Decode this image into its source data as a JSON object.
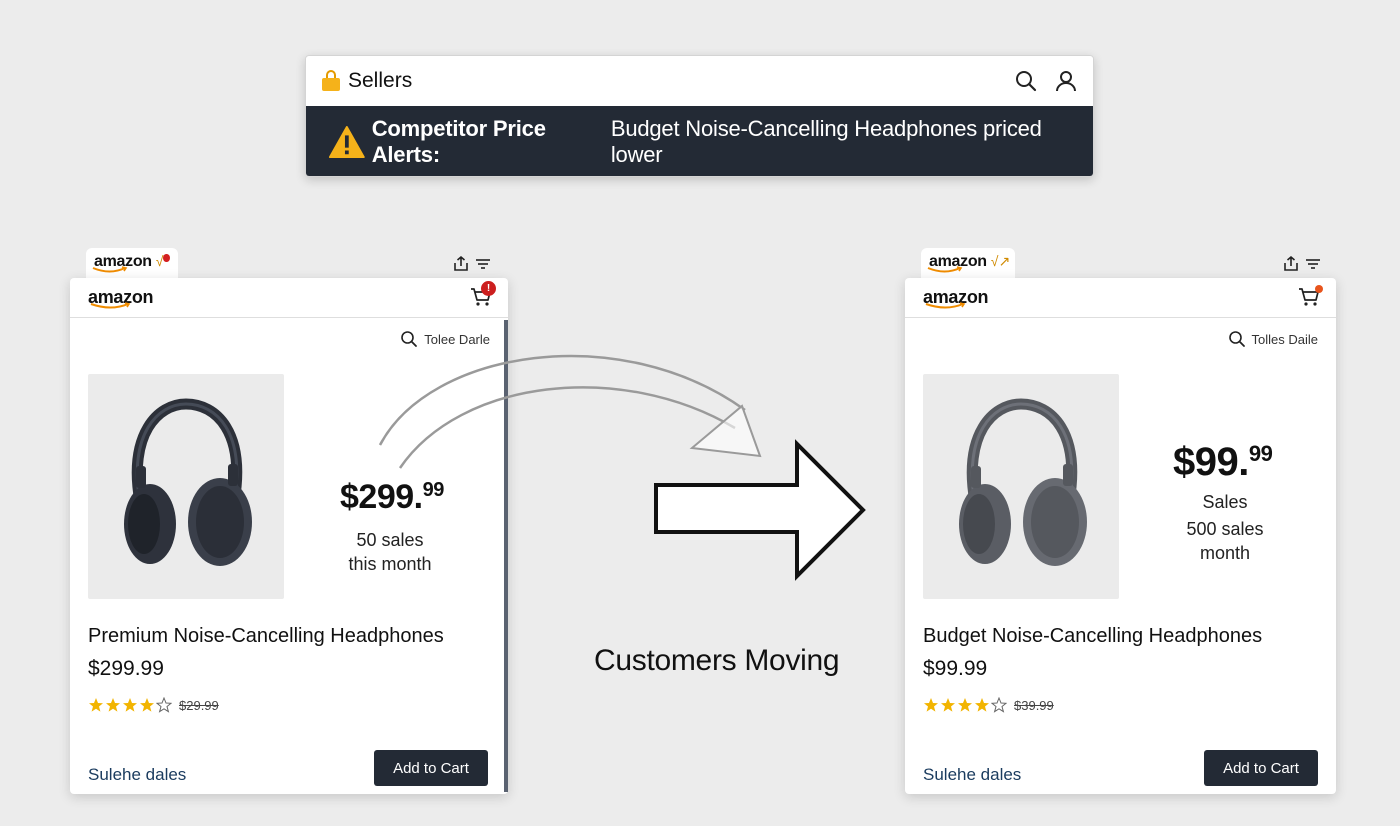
{
  "seller_header": {
    "title": "Sellers",
    "alert_label": "Competitor Price Alerts:",
    "alert_message": "Budget Noise-Cancelling Headphones priced lower"
  },
  "left_card": {
    "tab_logo": "amazon",
    "tab_extra": "√",
    "logo": "amazon",
    "cart_badge": "!",
    "search_text": "Tolee Darle",
    "price_main": "$299.",
    "price_cents": "99",
    "sales_line1": "50 sales",
    "sales_line2": "this month",
    "product_name": "Premium Noise-Cancelling Headphones",
    "product_price": "$299.99",
    "rating": 4,
    "old_price": "$29.99",
    "footer_link": "Sulehe dales",
    "add_to_cart": "Add to Cart"
  },
  "right_card": {
    "tab_logo": "amazon",
    "tab_extra": "√↗",
    "logo": "amazon",
    "search_text": "Tolles Daile",
    "price_main": "$99.",
    "price_cents": "99",
    "sales_line1": "Sales",
    "sales_line2": "500 sales",
    "sales_line3": "month",
    "product_name": "Budget Noise-Cancelling Headphones",
    "product_price": "$99.99",
    "rating": 4,
    "old_price": "$39.99",
    "footer_link": "Sulehe dales",
    "add_to_cart": "Add to Cart"
  },
  "center": {
    "label": "Customers Moving"
  },
  "colors": {
    "dark_navy": "#232a35",
    "star": "#f2b400",
    "warning": "#f5b21a",
    "badge_red": "#cc1f1f",
    "link_blue": "#1a3b5e"
  }
}
